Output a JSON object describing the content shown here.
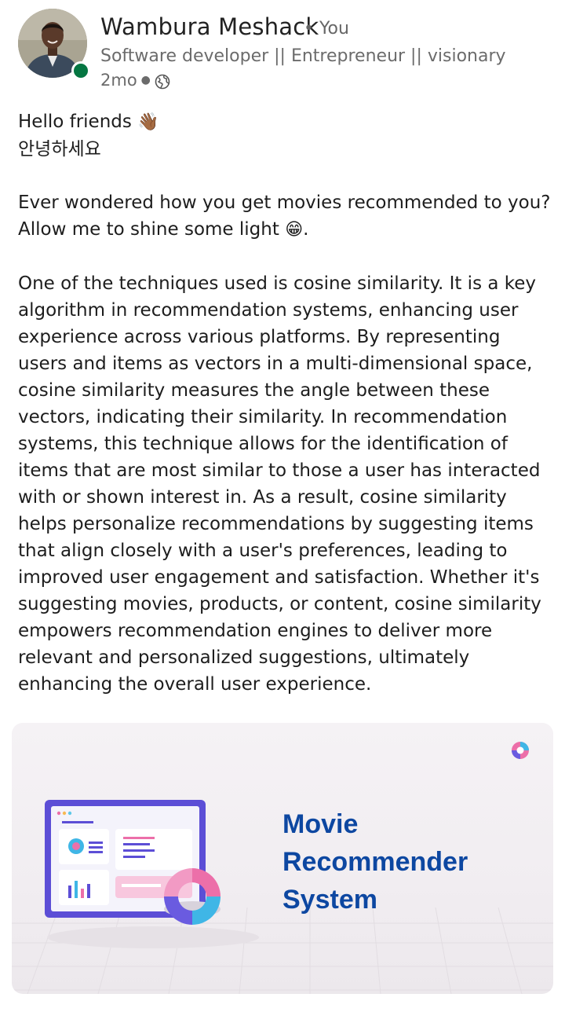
{
  "author": {
    "name": "Wambura Meshack",
    "relation": "You",
    "headline": "Software developer || Entrepreneur || visionary",
    "time": "2mo",
    "visibility_icon": "globe-icon"
  },
  "post": {
    "greeting": "Hello friends",
    "greeting_emoji": "👋🏾",
    "korean": "안녕하세요",
    "question": "Ever wondered how you get movies recommended to you?",
    "intro": "Allow me to shine some light",
    "intro_emoji": "😁",
    "intro_end": ".",
    "body": "One of the techniques used is cosine similarity. It is a key algorithm in recommendation systems, enhancing user experience across various platforms. By representing users and items as vectors in a multi-dimensional space, cosine similarity measures the angle between these vectors, indicating their similarity. In recommendation systems, this technique allows for the identification of items that are most similar to those a user has interacted with or shown interest in. As a result, cosine similarity helps personalize recommendations by suggesting items that align closely with a user's preferences, leading to improved user engagement and satisfaction. Whether it's suggesting movies, products, or content, cosine similarity empowers recommendation engines to deliver more relevant and personalized suggestions, ultimately enhancing the overall user experience."
  },
  "card": {
    "title_lines": [
      "Movie",
      "Recommender",
      "System"
    ],
    "title_color": "#0d47a1"
  },
  "colors": {
    "presence": "#057642",
    "accent_purple": "#5c4ed6"
  }
}
